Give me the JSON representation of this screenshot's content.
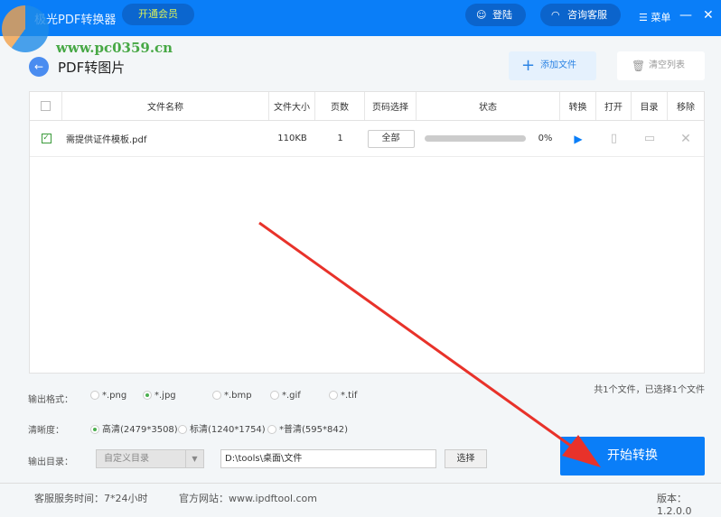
{
  "titlebar": {
    "title": "极光PDF转换器",
    "vip": "开通会员",
    "login": "登陆",
    "support": "咨询客服",
    "menu": "菜单",
    "minimize": "—",
    "close": "✕"
  },
  "watermark": "www.pc0359.cn",
  "page": {
    "title": "PDF转图片",
    "add_file": "添加文件",
    "clear_list": "清空列表"
  },
  "table": {
    "headers": [
      "文件名称",
      "文件大小",
      "页数",
      "页码选择",
      "状态",
      "转换",
      "打开",
      "目录",
      "移除"
    ],
    "rows": [
      {
        "name": "需提供证件模板.pdf",
        "size": "110KB",
        "pages": "1",
        "page_select": "全部",
        "progress_pct": 0,
        "progress": "0%"
      }
    ]
  },
  "summary": "共1个文件，已选择1个文件",
  "format": {
    "label": "输出格式：",
    "options": [
      "*.png",
      "*.jpg",
      "*.bmp",
      "*.gif",
      "*.tif"
    ],
    "selected": "*.jpg"
  },
  "quality": {
    "label": "清晰度：",
    "options": [
      "高清(2479*3508)",
      "标清(1240*1754)",
      "*普清(595*842)"
    ],
    "selected": "高清(2479*3508)"
  },
  "output": {
    "label": "输出目录：",
    "mode": "自定义目录",
    "path": "D:\\tools\\桌面\\文件",
    "choose": "选择"
  },
  "start": "开始转换",
  "footer": {
    "service": "客服服务时间：7*24小时",
    "website": "官方网站：www.ipdftool.com",
    "version": "版本：1.2.0.0"
  },
  "colors": {
    "primary": "#0a7ef8",
    "arrow": "#e8322a"
  }
}
